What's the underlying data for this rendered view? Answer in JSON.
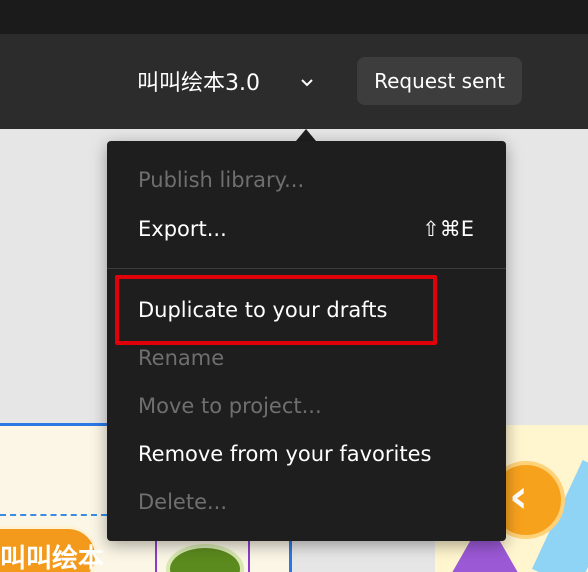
{
  "header": {
    "file_name": "叫叫绘本3.0",
    "request_button_label": "Request sent"
  },
  "menu": {
    "items": [
      {
        "label": "Publish library...",
        "enabled": false
      },
      {
        "label": "Export...",
        "enabled": true,
        "shortcut": "⇧⌘E"
      },
      {
        "label": "Duplicate to your drafts",
        "enabled": true,
        "highlighted": true
      },
      {
        "label": "Rename",
        "enabled": false
      },
      {
        "label": "Move to project...",
        "enabled": false
      },
      {
        "label": "Remove from your favorites",
        "enabled": true
      },
      {
        "label": "Delete...",
        "enabled": false
      }
    ]
  },
  "canvas": {
    "left_thumbnail_text": "叫叫绘本"
  },
  "colors": {
    "toolbar_bg": "#2c2c2c",
    "menu_bg": "#1e1e1e",
    "disabled_text": "#6f6f6f",
    "highlight_border": "#e0000a",
    "selection_blue": "#2a78e4"
  }
}
